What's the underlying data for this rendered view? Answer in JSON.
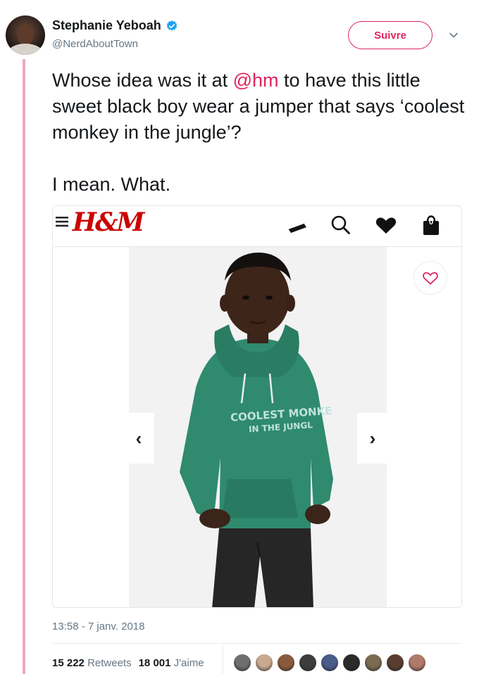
{
  "author": {
    "name": "Stephanie Yeboah",
    "handle": "@NerdAboutTown",
    "verified": true
  },
  "actions": {
    "follow_label": "Suivre",
    "more_icon": "chevron-down-icon"
  },
  "tweet": {
    "text_before_mention": "Whose idea was it at ",
    "mention": "@hm",
    "text_after_mention": " to have this little sweet black boy wear a jumper that says ‘coolest monkey in the jungle’?",
    "second_paragraph": "I mean. What."
  },
  "media": {
    "site_logo": "H&M",
    "header_icons": [
      "menu-icon",
      "card-icon",
      "search-icon",
      "heart-icon",
      "bag-icon"
    ],
    "bag_count": "0",
    "prev_arrow": "‹",
    "next_arrow": "›",
    "shirt_print_line1": "COOLEST MONKE",
    "shirt_print_line2": "IN THE JUNGL"
  },
  "footer": {
    "timestamp": "13:58 - 7 janv. 2018",
    "retweet_count": "15 222",
    "retweet_label": "Retweets",
    "like_count": "18 001",
    "like_label": "J'aime",
    "liker_colors": [
      "#6e6e6e",
      "#c9a890",
      "#8a5a3c",
      "#3d3d3d",
      "#4a5d8a",
      "#2b2b2b",
      "#7a6a4f",
      "#5a3d2e",
      "#b07a6a"
    ]
  },
  "colors": {
    "accent": "#e0245e",
    "thread_line": "#f2a7c4",
    "brand_red": "#cc0000",
    "hoodie_green": "#2f8a6e"
  }
}
